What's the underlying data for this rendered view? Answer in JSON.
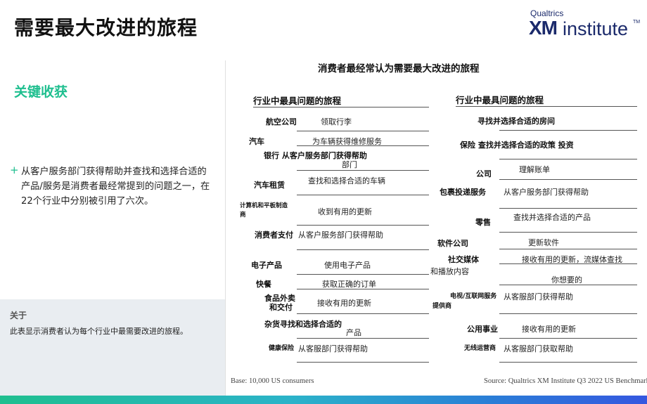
{
  "header": {
    "title": "需要最大改进的旅程",
    "logo_top": "Qualtrics",
    "logo_xm": "XM",
    "logo_institute": "institute",
    "logo_tm": "TM"
  },
  "left_panel": {
    "section_title": "关键收获",
    "takeaway_icon": "plus-icon",
    "takeaway_text": "从客户服务部门获得帮助并查找和选择合适的产品/服务是消费者最经常提到的问题之一，在22个行业中分别被引用了六次。",
    "about_title": "关于",
    "about_text": "此表显示消费者认为每个行业中最需要改进的旅程。"
  },
  "chart": {
    "title": "消费者最经常认为需要最大改进的旅程",
    "left_column_header": "行业中最具问题的旅程",
    "right_column_header": "行业中最具问题的旅程",
    "left_rows": [
      {
        "industry": "航空公司",
        "journey": "领取行李"
      },
      {
        "industry": "汽车",
        "journey": "为车辆获得维修服务"
      },
      {
        "industry": "银行 从客户服务部门获得帮助",
        "journey": "部门"
      },
      {
        "industry": "汽车租赁",
        "journey": "查找和选择合适的车辆"
      },
      {
        "industry": "计算机和平板制造",
        "industry_line2": "商",
        "journey": "收到有用的更新"
      },
      {
        "industry": "消费者支付",
        "journey": "从客户服务部门获得帮助"
      },
      {
        "industry": "电子产品",
        "journey": "使用电子产品"
      },
      {
        "industry": "快餐",
        "journey": "获取正确的订单"
      },
      {
        "industry": "食品外卖",
        "industry_line2": "和交付",
        "journey": "接收有用的更新"
      },
      {
        "industry": "杂货寻找和选择合适的",
        "journey": "产品"
      },
      {
        "industry": "健康保险",
        "journey": "从客服部门获得帮助"
      }
    ],
    "right_rows": [
      {
        "industry": "",
        "journey": "寻找并选择合适的房间"
      },
      {
        "industry": "",
        "journey": "保险 查找并选择合适的政策 投资"
      },
      {
        "industry": "公司",
        "journey": "理解账单"
      },
      {
        "industry": "包裹投递服务",
        "journey": "从客户服务部门获得帮助"
      },
      {
        "industry": "零售",
        "journey": "查找并选择合适的产品"
      },
      {
        "industry": "软件公司",
        "journey": "更新软件"
      },
      {
        "industry": "社交媒体",
        "industry_line2": "和播放内容",
        "journey": "接收有用的更新，流媒体查找"
      },
      {
        "industry": "",
        "journey": "你想要的"
      },
      {
        "industry": "电视/互联网服务",
        "industry_line2": "提供商",
        "journey": "从客服部门获得帮助"
      },
      {
        "industry": "公用事业",
        "journey": "接收有用的更新"
      },
      {
        "industry": "无线运营商",
        "journey": "从客服部门获取帮助"
      }
    ]
  },
  "footer": {
    "base": "Base: 10,000 US consumers",
    "source": "Source: Qualtrics XM Institute Q3 2022 US Benchmark Study"
  },
  "colors": {
    "accent_green": "#1fbf8f",
    "brand_navy": "#1b2a6b",
    "about_bg": "#e9edf1"
  }
}
